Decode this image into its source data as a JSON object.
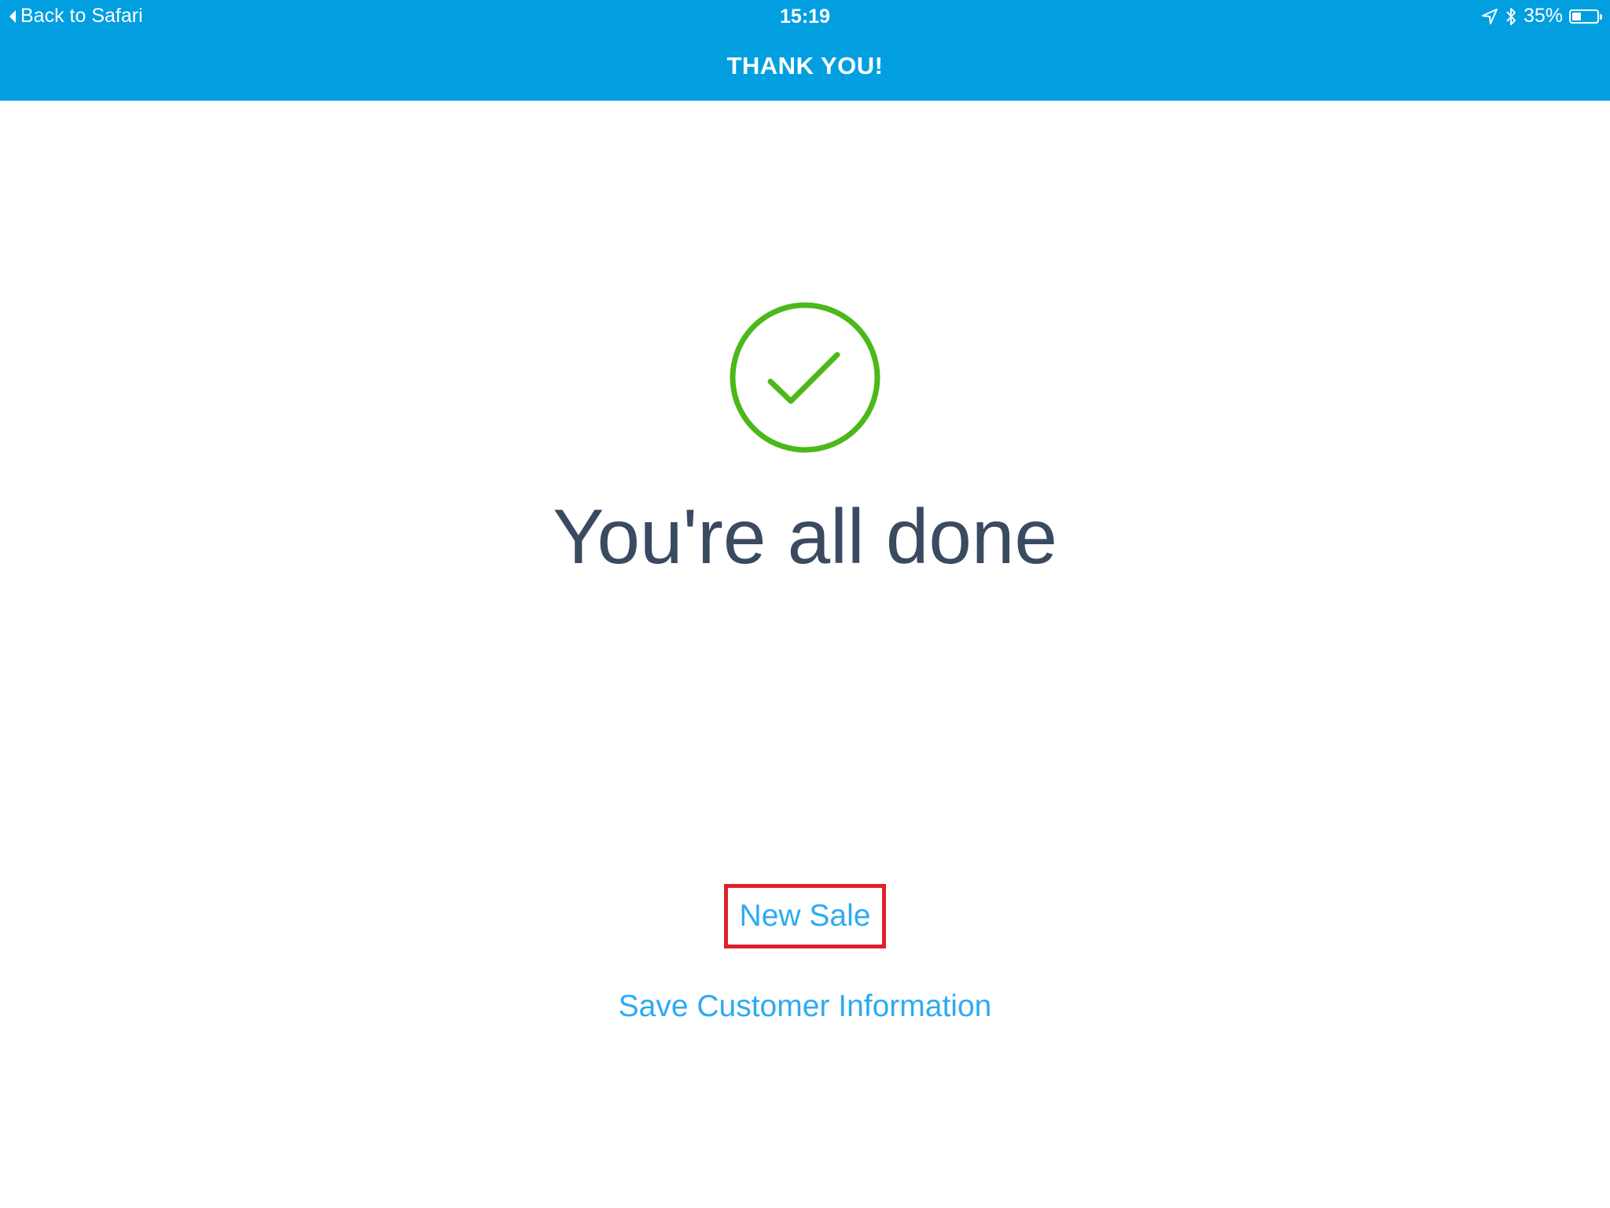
{
  "status_bar": {
    "back_label": "Back to Safari",
    "time": "15:19",
    "battery_text": "35%",
    "battery_level": 0.35,
    "icons": [
      "location-arrow-icon",
      "bluetooth-icon",
      "battery-icon"
    ]
  },
  "header": {
    "title": "THANK YOU!",
    "background_color": "#029fe0"
  },
  "main": {
    "status_icon": "check-circle-icon",
    "status_color": "#4cb81a",
    "heading": "You're all done"
  },
  "actions": {
    "new_sale_label": "New Sale",
    "save_customer_label": "Save Customer Information",
    "link_color": "#2eaaf2",
    "highlight_color": "#e0202c"
  }
}
